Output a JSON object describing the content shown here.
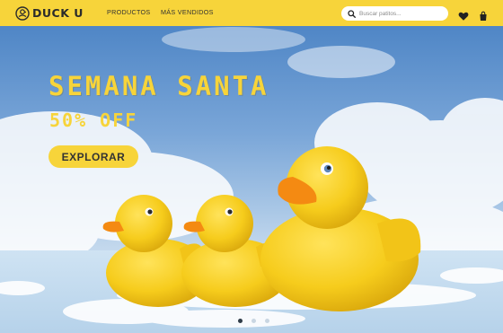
{
  "brand": {
    "name": "DUCK U",
    "logo_icon": "duck-icon"
  },
  "nav": {
    "products": "PRODUCTOS",
    "best_sellers": "MÁS VENDIDOS"
  },
  "search": {
    "placeholder": "Buscar patitos...",
    "value": ""
  },
  "icons": {
    "search": "search-icon",
    "favorites": "heart-icon",
    "cart": "cart-icon"
  },
  "hero": {
    "title": "SEMANA SANTA",
    "subtitle": "50% OFF",
    "cta_label": "EXPLORAR",
    "slides": {
      "count": 3,
      "active": 1
    }
  },
  "colors": {
    "brand_yellow": "#f7d43a",
    "text_dark": "#333333",
    "sky_blue": "#7aa6d8"
  }
}
